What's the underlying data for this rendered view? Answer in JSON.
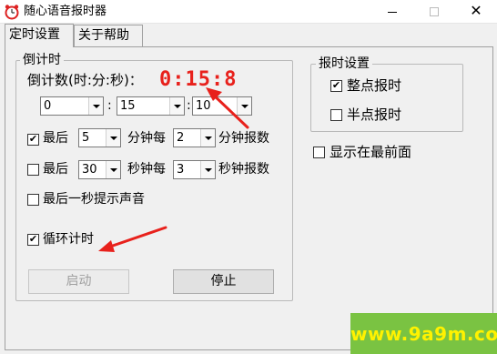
{
  "window": {
    "title": "随心语音报时器",
    "close_glyph": "✕",
    "icon": "alarm-clock-icon"
  },
  "tabs": [
    {
      "label": "定时设置",
      "active": true
    },
    {
      "label": "关于帮助",
      "active": false
    }
  ],
  "countdown_group": {
    "legend": "倒计时",
    "count_label": "倒计数(时:分:秒)：",
    "display": "0:15:8",
    "hours": "0",
    "minutes": "15",
    "seconds": "10",
    "separator": ":",
    "rule1": {
      "checked": true,
      "prefix": "最后",
      "value1": "5",
      "mid": "分钟每",
      "value2": "2",
      "suffix": "分钟报数"
    },
    "rule2": {
      "checked": false,
      "prefix": "最后",
      "value1": "30",
      "mid": "秒钟每",
      "value2": "3",
      "suffix": "秒钟报数"
    },
    "rule3": {
      "checked": false,
      "label": "最后一秒提示声音"
    },
    "loop": {
      "checked": true,
      "label": "循环计时"
    },
    "start_label": "启动",
    "stop_label": "停止"
  },
  "chime_group": {
    "legend": "报时设置",
    "hourly": {
      "checked": true,
      "label": "整点报时"
    },
    "half_hourly": {
      "checked": false,
      "label": "半点报时"
    }
  },
  "topmost": {
    "checked": false,
    "label": "显示在最前面"
  },
  "check_glyph": "✔",
  "watermark": {
    "text": "www.9a9m.com"
  },
  "colors": {
    "countdown": "#e8211c",
    "arrow": "#e8211c",
    "watermark_bg": "#7ac342",
    "watermark_text": "#fff200"
  }
}
